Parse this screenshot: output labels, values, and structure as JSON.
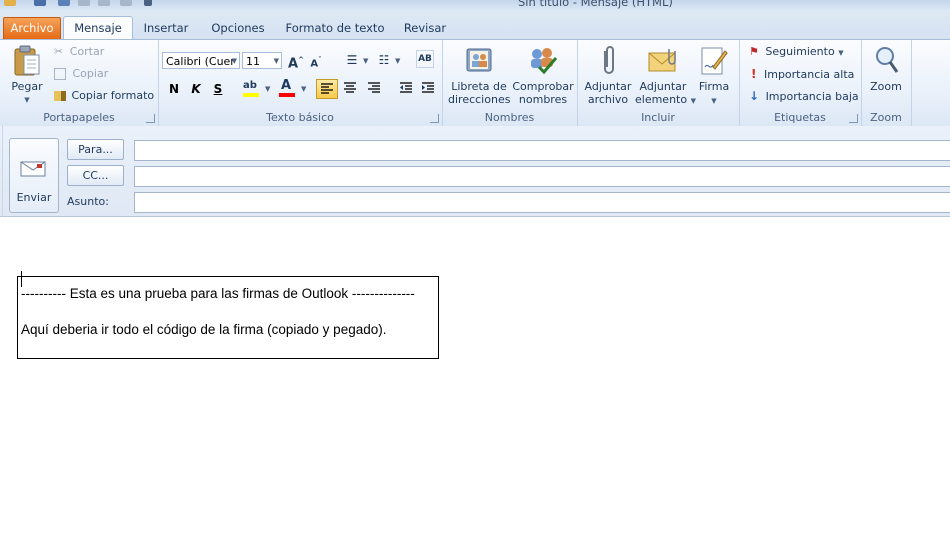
{
  "window": {
    "title": "Sin título  -  Mensaje (HTML)"
  },
  "tabs": [
    "Archivo",
    "Mensaje",
    "Insertar",
    "Opciones",
    "Formato de texto",
    "Revisar"
  ],
  "ribbon": {
    "clipboard": {
      "label": "Portapapeles",
      "paste": "Pegar",
      "cut": "Cortar",
      "copy": "Copiar",
      "format_painter": "Copiar formato"
    },
    "basic_text": {
      "label": "Texto básico",
      "font": "Calibri (Cuer",
      "size": "11",
      "bold": "N",
      "italic": "K",
      "underline": "S"
    },
    "names": {
      "label": "Nombres",
      "address_book": [
        "Libreta de",
        "direcciones"
      ],
      "check_names": [
        "Comprobar",
        "nombres"
      ]
    },
    "include": {
      "label": "Incluir",
      "attach_file": [
        "Adjuntar",
        "archivo"
      ],
      "attach_item": [
        "Adjuntar",
        "elemento"
      ],
      "signature": "Firma"
    },
    "tags": {
      "label": "Etiquetas",
      "follow_up": "Seguimiento",
      "high_importance": "Importancia alta",
      "low_importance": "Importancia baja"
    },
    "zoom": {
      "label": "Zoom",
      "button": "Zoom"
    }
  },
  "compose": {
    "send": "Enviar",
    "to": "Para...",
    "cc": "CC...",
    "subject_label": "Asunto:",
    "to_value": "",
    "cc_value": "",
    "subject_value": ""
  },
  "body": {
    "line1": "---------- Esta es una prueba para las firmas de Outlook --------------",
    "line2": "Aquí deberia ir todo el código de la firma (copiado y pegado)."
  },
  "colors": {
    "file_tab": "#e46b15",
    "ribbon": "#dfe9f5",
    "highlight": "#ffff00",
    "font_color": "#ff0000"
  }
}
